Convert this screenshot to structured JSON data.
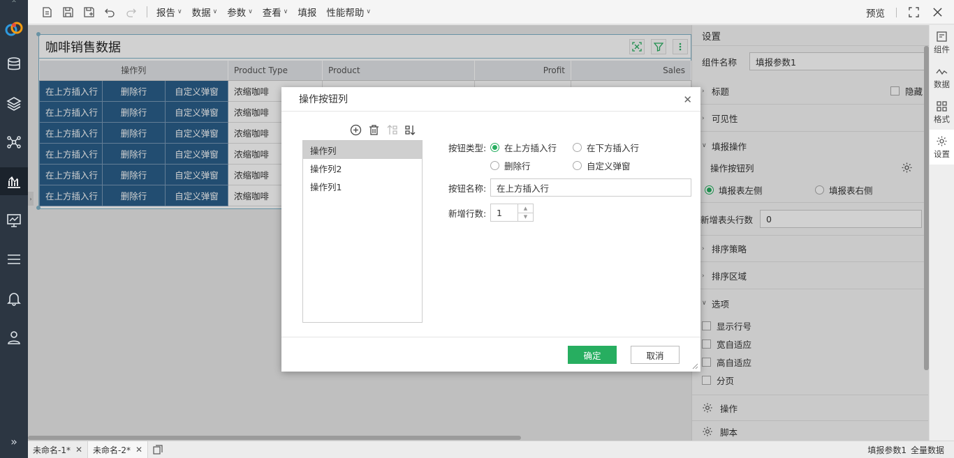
{
  "toolbar": {
    "menus": [
      "报告",
      "数据",
      "参数",
      "查看",
      "填报",
      "性能帮助"
    ],
    "preview": "预览"
  },
  "widget": {
    "title": "咖啡销售数据",
    "columns": [
      "操作列",
      "Product Type",
      "Product",
      "Profit",
      "Sales"
    ],
    "rows": [
      [
        "在上方插入行",
        "删除行",
        "自定义弹窗",
        "浓缩咖啡"
      ],
      [
        "在上方插入行",
        "删除行",
        "自定义弹窗",
        "浓缩咖啡"
      ],
      [
        "在上方插入行",
        "删除行",
        "自定义弹窗",
        "浓缩咖啡"
      ],
      [
        "在上方插入行",
        "删除行",
        "自定义弹窗",
        "浓缩咖啡"
      ],
      [
        "在上方插入行",
        "删除行",
        "自定义弹窗",
        "浓缩咖啡"
      ],
      [
        "在上方插入行",
        "删除行",
        "自定义弹窗",
        "浓缩咖啡"
      ]
    ]
  },
  "settings": {
    "header": "设置",
    "component_name_label": "组件名称",
    "component_name_value": "填报参数1",
    "title_section": "标题",
    "hide_label": "隐藏",
    "visibility_section": "可见性",
    "fill_ops_section": "填报操作",
    "op_button_col": "操作按钮列",
    "left_label": "填报表左侧",
    "right_label": "填报表右侧",
    "header_rows_label": "新增表头行数",
    "header_rows_value": "0",
    "sort_strategy": "排序策略",
    "sort_area": "排序区域",
    "options_section": "选项",
    "opt_row_number": "显示行号",
    "opt_width_fit": "宽自适应",
    "opt_height_fit": "高自适应",
    "opt_paging": "分页",
    "operations": "操作",
    "script": "脚本"
  },
  "right_tabs": [
    "组件",
    "数据",
    "格式",
    "设置"
  ],
  "bottom": {
    "tabs": [
      "未命名-1*",
      "未命名-2*"
    ],
    "status_1": "填报参数1",
    "status_2": "全量数据"
  },
  "dialog": {
    "title": "操作按钮列",
    "list": [
      "操作列",
      "操作列2",
      "操作列1"
    ],
    "type_label": "按钮类型:",
    "type_options": [
      "在上方插入行",
      "在下方插入行",
      "删除行",
      "自定义弹窗"
    ],
    "name_label": "按钮名称:",
    "name_value": "在上方插入行",
    "rows_label": "新增行数:",
    "rows_value": "1",
    "ok": "确定",
    "cancel": "取消"
  },
  "colors": {
    "accent": "#27ae60",
    "op_cell": "#2a5f8a",
    "sidebar": "#2c3642"
  }
}
